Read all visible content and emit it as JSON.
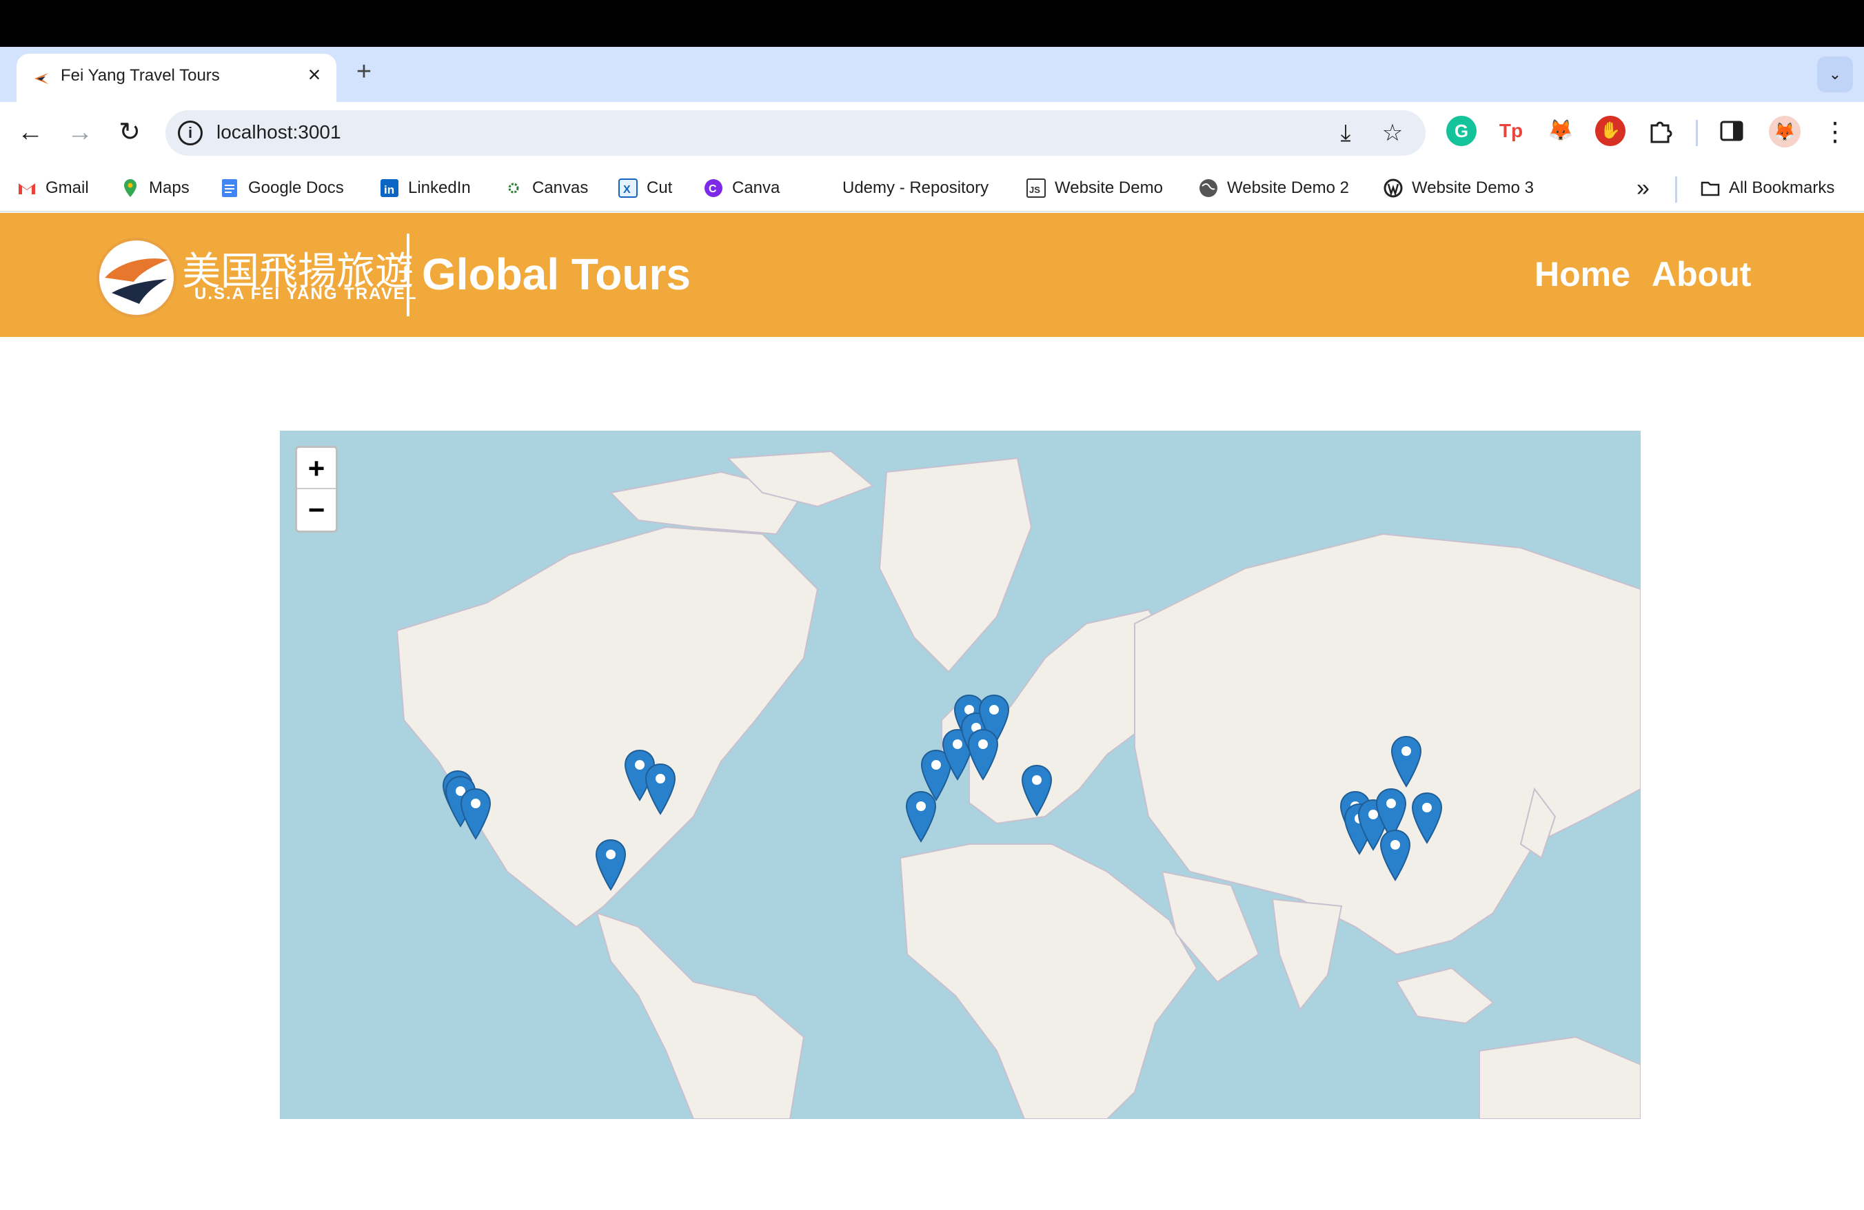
{
  "browser": {
    "tab_title": "Fei Yang Travel Tours",
    "close_glyph": "×",
    "new_tab_glyph": "+",
    "tab_list_glyph": "⌄",
    "url": "localhost:3001",
    "back_glyph": "←",
    "forward_glyph": "→",
    "reload_glyph": "↻",
    "install_glyph": "⤓",
    "star_glyph": "☆",
    "menu_glyph": "⋮",
    "extensions": [
      {
        "name": "grammarly-extension-icon",
        "letter": "G",
        "color": "#15c39a"
      },
      {
        "name": "tp-extension-icon",
        "letter": "Tp",
        "color": "#e8453c"
      },
      {
        "name": "metamask-extension-icon",
        "letter": "🦊",
        "color": "#f6851b"
      },
      {
        "name": "adblock-extension-icon",
        "letter": "✋",
        "color": "#d93025"
      }
    ],
    "bookmarks": [
      {
        "label": "Gmail",
        "icon": "gmail-icon",
        "color": "#ea4335"
      },
      {
        "label": "Maps",
        "icon": "maps-icon",
        "color": "#34a853"
      },
      {
        "label": "Google Docs",
        "icon": "google-docs-icon",
        "color": "#4285f4"
      },
      {
        "label": "LinkedIn",
        "icon": "linkedin-icon",
        "color": "#0a66c2"
      },
      {
        "label": "Canvas",
        "icon": "canvas-icon",
        "color": "#2e7d32"
      },
      {
        "label": "Cut",
        "icon": "cut-icon",
        "color": "#1565c0"
      },
      {
        "label": "Canva",
        "icon": "canva-icon",
        "color": "#7d2ae8"
      },
      {
        "label": "Udemy - Repository",
        "icon": "udemy-icon",
        "color": "#ffffff"
      },
      {
        "label": "Website Demo",
        "icon": "js-icon",
        "color": "#333333"
      },
      {
        "label": "Website Demo 2",
        "icon": "globe-icon",
        "color": "#555555"
      },
      {
        "label": "Website Demo 3",
        "icon": "wordpress-icon",
        "color": "#222222"
      }
    ],
    "more_bookmarks_glyph": "»",
    "all_bookmarks": "All Bookmarks"
  },
  "header": {
    "logo_cn": "美国飛揚旅遊",
    "logo_en": "U.S.A FEI YANG TRAVEL",
    "title": "Global Tours",
    "nav": [
      {
        "label": "Home"
      },
      {
        "label": "About"
      }
    ],
    "color": "#f2a93b"
  },
  "map": {
    "zoom_in": "+",
    "zoom_out": "−",
    "water_color": "#aad3df",
    "land_color": "#f2efe9",
    "marker_color": "#2a81cb",
    "tour_markers": [
      {
        "region": "California-1"
      },
      {
        "region": "California-2"
      },
      {
        "region": "California-3"
      },
      {
        "region": "Florida"
      },
      {
        "region": "Great Lakes"
      },
      {
        "region": "New York"
      },
      {
        "region": "Portugal"
      },
      {
        "region": "Spain"
      },
      {
        "region": "France"
      },
      {
        "region": "Netherlands"
      },
      {
        "region": "Belgium"
      },
      {
        "region": "Germany"
      },
      {
        "region": "Switzerland"
      },
      {
        "region": "Greece"
      },
      {
        "region": "China-West-1"
      },
      {
        "region": "China-West-2"
      },
      {
        "region": "China-Central-1"
      },
      {
        "region": "China-Central-2"
      },
      {
        "region": "China-South"
      },
      {
        "region": "China-North"
      },
      {
        "region": "China-East"
      }
    ]
  }
}
